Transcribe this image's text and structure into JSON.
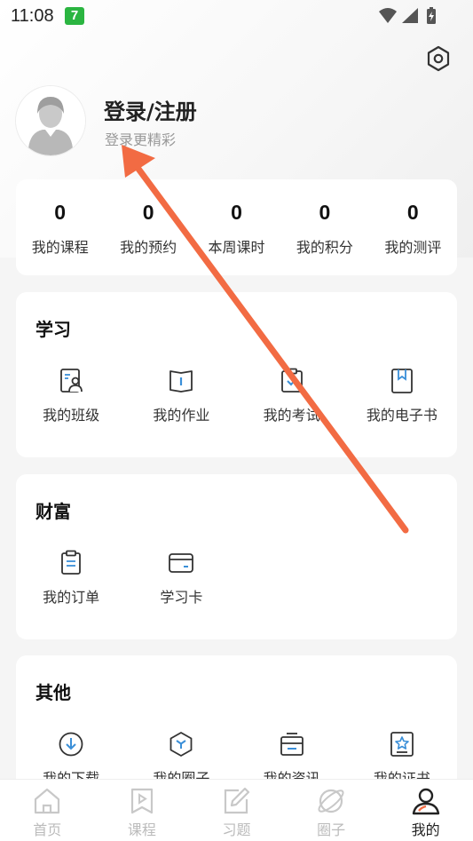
{
  "status_bar": {
    "time": "11:08",
    "app_badge": "7"
  },
  "profile": {
    "title": "登录/注册",
    "subtitle": "登录更精彩"
  },
  "stats": [
    {
      "value": "0",
      "label": "我的课程"
    },
    {
      "value": "0",
      "label": "我的预约"
    },
    {
      "value": "0",
      "label": "本周课时"
    },
    {
      "value": "0",
      "label": "我的积分"
    },
    {
      "value": "0",
      "label": "我的测评"
    }
  ],
  "study": {
    "title": "学习",
    "items": [
      {
        "label": "我的班级",
        "icon": "class-icon"
      },
      {
        "label": "我的作业",
        "icon": "homework-book-icon"
      },
      {
        "label": "我的考试",
        "icon": "exam-clipboard-icon"
      },
      {
        "label": "我的电子书",
        "icon": "ebook-bookmark-icon"
      }
    ]
  },
  "wealth": {
    "title": "财富",
    "items": [
      {
        "label": "我的订单",
        "icon": "order-clipboard-icon"
      },
      {
        "label": "学习卡",
        "icon": "study-card-icon"
      }
    ]
  },
  "other": {
    "title": "其他",
    "items": [
      {
        "label": "我的下载",
        "icon": "download-icon"
      },
      {
        "label": "我的圈子",
        "icon": "circle-hexagon-icon"
      },
      {
        "label": "我的资讯",
        "icon": "news-icon"
      },
      {
        "label": "我的证书",
        "icon": "certificate-icon"
      }
    ]
  },
  "tabbar": [
    {
      "label": "首页",
      "icon": "home-icon",
      "active": false
    },
    {
      "label": "课程",
      "icon": "course-play-icon",
      "active": false
    },
    {
      "label": "习题",
      "icon": "exercise-edit-icon",
      "active": false
    },
    {
      "label": "圈子",
      "icon": "planet-icon",
      "active": false
    },
    {
      "label": "我的",
      "icon": "user-icon",
      "active": true
    }
  ],
  "colors": {
    "accent_blue": "#3a8fd8",
    "annotation_arrow": "#f26b43",
    "active_tab": "#222222"
  }
}
